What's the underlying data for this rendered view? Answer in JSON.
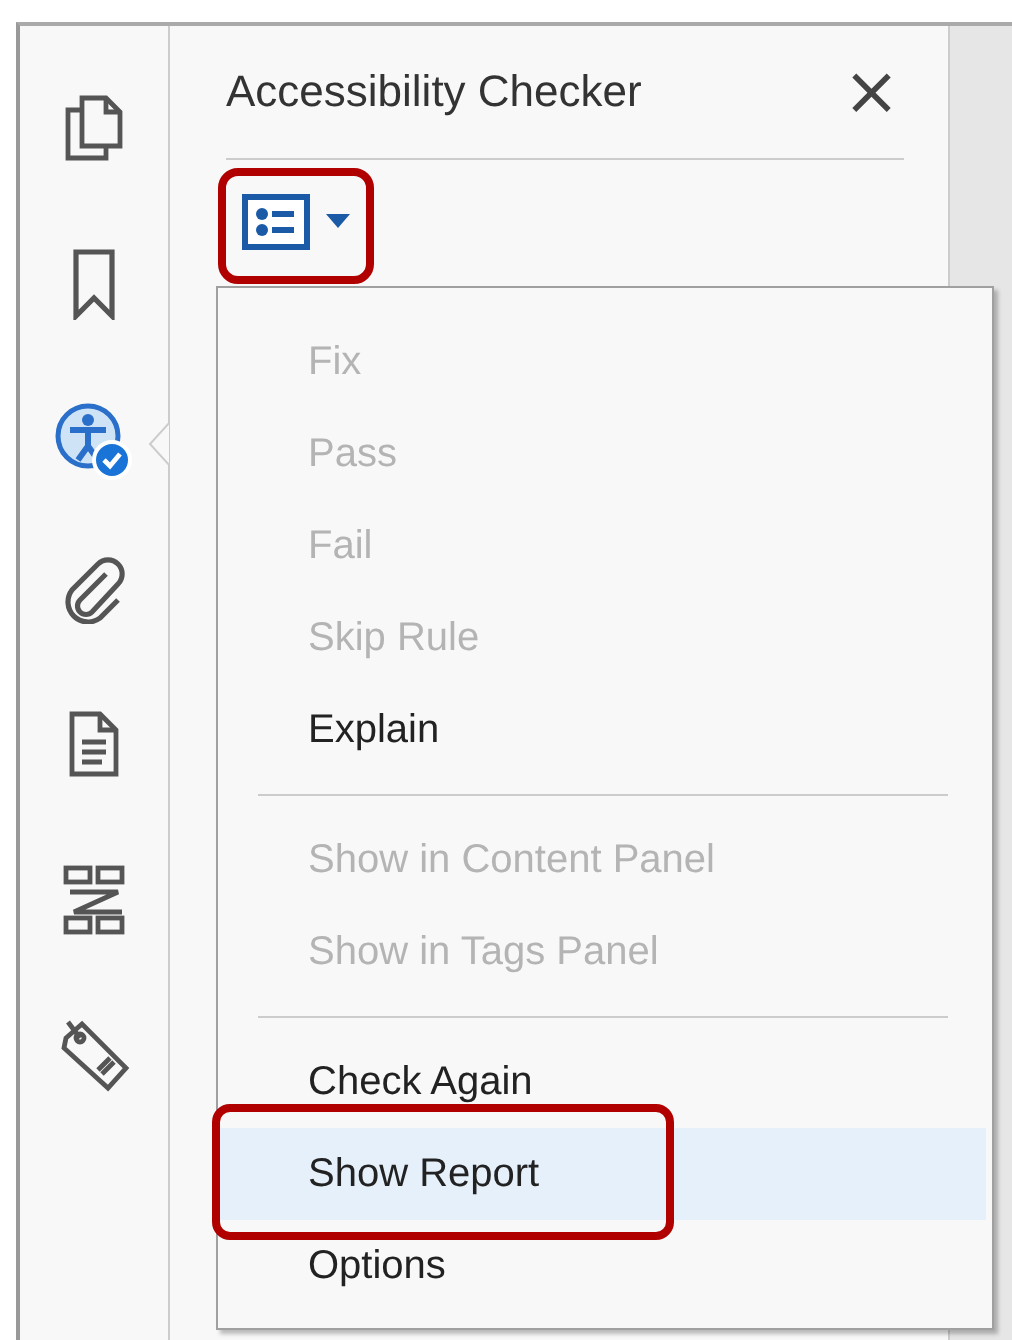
{
  "sidebar": {
    "items": [
      {
        "kind": "pages",
        "selected": false
      },
      {
        "kind": "bookmark",
        "selected": false
      },
      {
        "kind": "accessibility",
        "selected": true
      },
      {
        "kind": "attachment",
        "selected": false
      },
      {
        "kind": "document",
        "selected": false
      },
      {
        "kind": "compare",
        "selected": false
      },
      {
        "kind": "tag",
        "selected": false
      }
    ]
  },
  "panel": {
    "title": "Accessibility Checker",
    "close": "×",
    "options_button": {
      "highlighted": true
    }
  },
  "menu": {
    "groups": [
      [
        {
          "label": "Fix",
          "disabled": true,
          "selected": false,
          "highlighted": false
        },
        {
          "label": "Pass",
          "disabled": true,
          "selected": false,
          "highlighted": false
        },
        {
          "label": "Fail",
          "disabled": true,
          "selected": false,
          "highlighted": false
        },
        {
          "label": "Skip Rule",
          "disabled": true,
          "selected": false,
          "highlighted": false
        },
        {
          "label": "Explain",
          "disabled": false,
          "selected": false,
          "highlighted": false
        }
      ],
      [
        {
          "label": "Show in Content Panel",
          "disabled": true,
          "selected": false,
          "highlighted": false
        },
        {
          "label": "Show in Tags Panel",
          "disabled": true,
          "selected": false,
          "highlighted": false
        }
      ],
      [
        {
          "label": "Check Again",
          "disabled": false,
          "selected": false,
          "highlighted": false
        },
        {
          "label": "Show Report",
          "disabled": false,
          "selected": true,
          "highlighted": true
        },
        {
          "label": "Options",
          "disabled": false,
          "selected": false,
          "highlighted": false
        }
      ]
    ]
  }
}
